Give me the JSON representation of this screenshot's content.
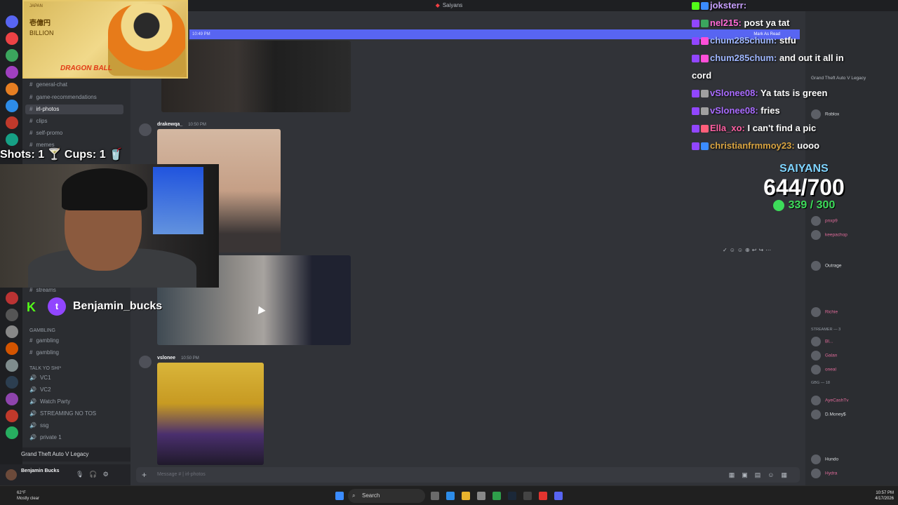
{
  "window": {
    "title": "Saiyans"
  },
  "overlay": {
    "card_lines": [
      "JAPAN",
      "壱億円",
      "BILLION",
      "DRAGON BALL"
    ],
    "shots_cups": "Shots: 1 🍸 Cups: 1 🥤",
    "streamer_name": "Benjamin_bucks"
  },
  "chat": [
    {
      "user": "joksterr:",
      "text": "",
      "color": "#c8a0ff"
    },
    {
      "user": "nel215:",
      "text": "post ya tat",
      "color": "#ff6ad5"
    },
    {
      "user": "chum285chum:",
      "text": "stfu",
      "color": "#9fb7ff"
    },
    {
      "user": "chum285chum:",
      "text": "and out it all in",
      "color": "#9fb7ff"
    },
    {
      "user": "",
      "text": "cord",
      "color": "#ffffff"
    },
    {
      "user": "vSlonee08:",
      "text": "Ya tats is green",
      "color": "#a96bff"
    },
    {
      "user": "vSlonee08:",
      "text": "fries",
      "color": "#a96bff"
    },
    {
      "user": "Ella_xo:",
      "text": "I can't find a pic",
      "color": "#ff5fa2"
    },
    {
      "user": "christianfrmmoy23:",
      "text": "uooo",
      "color": "#d9a441"
    }
  ],
  "goal": {
    "title": "SAIYANS",
    "count": "644/700",
    "sub": "339 / 300"
  },
  "sidebar": {
    "channels_top": [
      "general-chat",
      "game-recommendations",
      "irl-photos",
      "clips",
      "self-promo",
      "memes"
    ],
    "active_channel": "irl-photos",
    "streams": "streams",
    "category_gambling": "gambling",
    "gambling": [
      "gambling",
      "gambling"
    ],
    "category_voice": "TALK YO SHI*",
    "voice": [
      "VC1",
      "VC2",
      "Watch Party",
      "STREAMING NO TOS",
      "ssg",
      "private 1"
    ],
    "activity": "Grand Theft Auto V Legacy",
    "user": "Benjamin Bucks"
  },
  "main": {
    "banner_time": "10:49 PM",
    "mark_read": "Mark As Read",
    "messages": [
      {
        "user": "drakewqa_",
        "time": "10:50 PM"
      },
      {
        "user": "vslonee",
        "time": "10:50 PM"
      }
    ],
    "composer_placeholder": "Message # | irl-photos"
  },
  "members": {
    "playing": "Grand Theft Auto V Legacy",
    "list": [
      "Roblox",
      "pnxp9",
      "keepachop",
      "Outrage",
      "Richie",
      "Bl...",
      "Galan",
      "oneal",
      "AyeCashTv",
      "D.Money$",
      "Hundo",
      "Hydra"
    ],
    "groups": [
      "Streamer — 3",
      "GBG — 18"
    ]
  },
  "taskbar": {
    "search": "Search",
    "weather": "62°F",
    "weather_desc": "Mostly clear",
    "time": "10:57 PM",
    "date": "4/17/2026"
  }
}
